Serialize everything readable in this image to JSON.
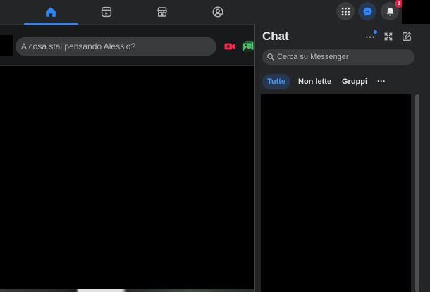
{
  "nav": {
    "tabs": [
      {
        "icon": "home-icon",
        "active": true
      },
      {
        "icon": "reels-icon",
        "active": false
      },
      {
        "icon": "marketplace-icon",
        "active": false
      },
      {
        "icon": "groups-icon",
        "active": false
      }
    ],
    "notifications_badge": "1"
  },
  "composer": {
    "placeholder": "A cosa stai pensando Alessio?",
    "icons": [
      "live-video-icon",
      "photo-icon"
    ]
  },
  "chat": {
    "title": "Chat",
    "actions": [
      "more-options-icon",
      "expand-icon",
      "new-message-icon"
    ],
    "search_placeholder": "Cerca su Messenger",
    "filters": [
      "Tutte",
      "Non lette",
      "Gruppi"
    ],
    "filters_more": "···"
  },
  "colors": {
    "accent": "#2d88ff",
    "background": "#18191a",
    "surface": "#242526",
    "badge": "#e41e3f"
  }
}
